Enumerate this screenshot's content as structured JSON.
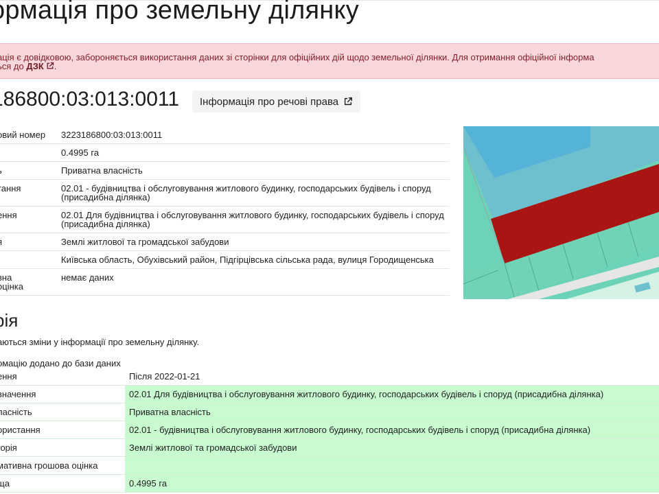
{
  "page": {
    "title": "ормація про земельну ділянку"
  },
  "alert": {
    "line1": "ація є довідковою, забороняється використання даних зі сторінки для офіційних дій щодо земельної ділянки. Для отримання офіційної інформа",
    "line2_prefix": "ься до ",
    "link_text": "ДЗК",
    "line2_suffix": ".",
    "icon": "external-link-icon"
  },
  "parcel": {
    "number": "186800:03:013:0011",
    "rights_button": "Інформація про речові права",
    "rights_icon": "external-link-icon"
  },
  "info_rows": [
    {
      "label": "овий номер",
      "value": "3223186800:03:013:0011"
    },
    {
      "label": "",
      "value": "0.4995 га"
    },
    {
      "label": "ь",
      "value": "Приватна власність"
    },
    {
      "label": "тання",
      "value": "02.01 - будівництва і обслуговування житлового будинку, господарських будівель і споруд (присадибна ділянка)"
    },
    {
      "label": "ення",
      "value": "02.01 Для будівництва і обслуговування житлового будинку, господарських будівель і споруд (присадибна ділянка)"
    },
    {
      "label": "я",
      "value": "Землі житлової та громадської забудови"
    },
    {
      "label": "",
      "value": "Київська область, Обухівський район, Підгірцівська сільська рада, вулиця Городищенська"
    },
    {
      "label": "вна\n оцінка",
      "value": "немає даних"
    }
  ],
  "history": {
    "title": "рія",
    "description": "аються зміни у інформації про земельну ділянку.",
    "added_label": "омацію додано до бази даних",
    "rows": [
      {
        "label": "ення",
        "value": "Після 2022-01-21",
        "changed": false
      },
      {
        "label": "вначення",
        "value": "02.01 Для будівництва і обслуговування житлового будинку, господарських будівель і споруд (присадибна ділянка)",
        "changed": true
      },
      {
        "label": "ласність",
        "value": "Приватна власність",
        "changed": true
      },
      {
        "label": "ористання",
        "value": "02.01 - будівництва і обслуговування житлового будинку, господарських будівель і споруд (присадибна ділянка)",
        "changed": true
      },
      {
        "label": "горія",
        "value": "Землі житлової та громадської забудови",
        "changed": true
      },
      {
        "label": "мативна грошова оцінка",
        "value": "",
        "changed": true
      },
      {
        "label": "ща",
        "value": "0.4995 га",
        "changed": true
      }
    ]
  },
  "colors": {
    "alert_bg": "#f8d7da",
    "alert_text": "#842029",
    "changed_row": "#c9fbd0",
    "parcel_fill": "#a81513",
    "map_green": "#6cd3b8",
    "map_blue": "#5bb8d8"
  }
}
